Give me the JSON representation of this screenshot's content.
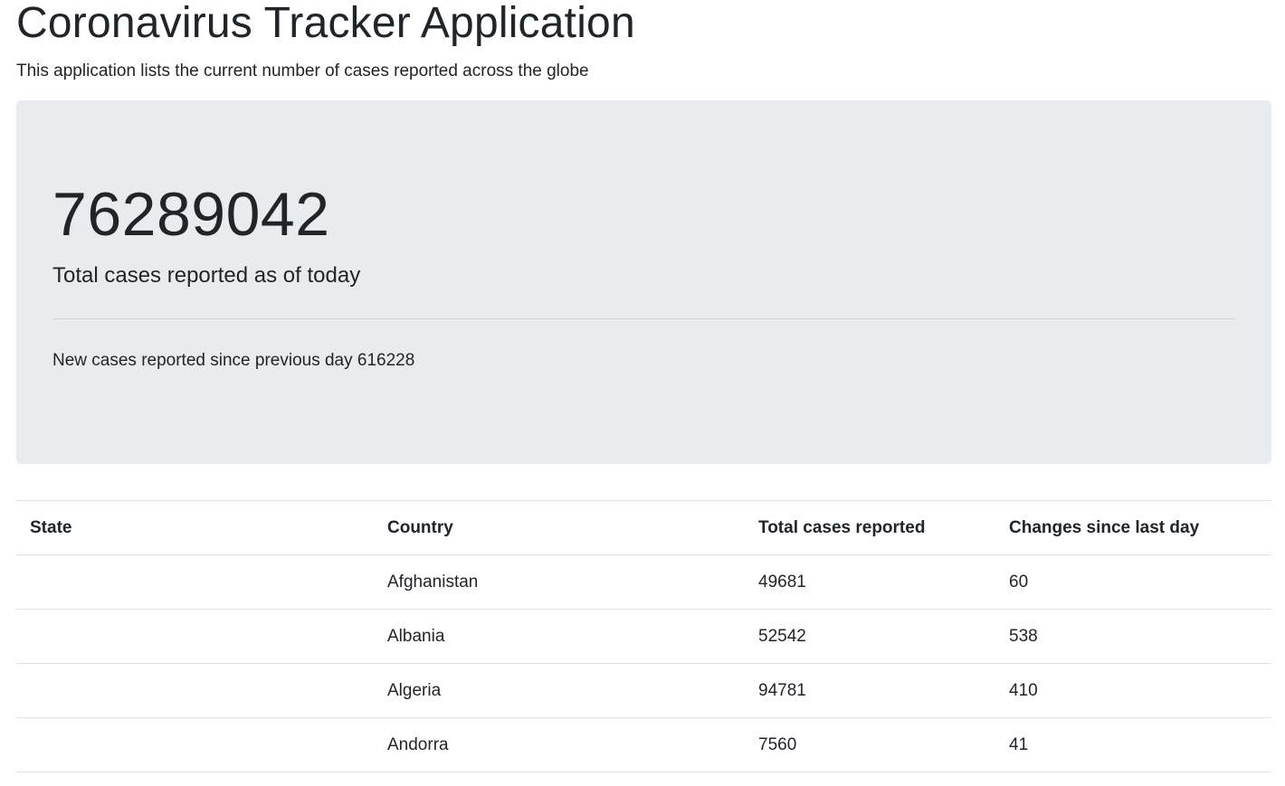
{
  "header": {
    "title": "Coronavirus Tracker Application",
    "subtitle": "This application lists the current number of cases reported across the globe"
  },
  "summary": {
    "total_cases": "76289042",
    "total_label": "Total cases reported as of today",
    "new_cases_text": "New cases reported since previous day 616228"
  },
  "table": {
    "columns": [
      "State",
      "Country",
      "Total cases reported",
      "Changes since last day"
    ],
    "rows": [
      {
        "state": "",
        "country": "Afghanistan",
        "total": "49681",
        "change": "60"
      },
      {
        "state": "",
        "country": "Albania",
        "total": "52542",
        "change": "538"
      },
      {
        "state": "",
        "country": "Algeria",
        "total": "94781",
        "change": "410"
      },
      {
        "state": "",
        "country": "Andorra",
        "total": "7560",
        "change": "41"
      }
    ]
  },
  "colors": {
    "jumbotron_bg": "#e9ecef",
    "text": "#212529",
    "border": "#dee2e6"
  }
}
